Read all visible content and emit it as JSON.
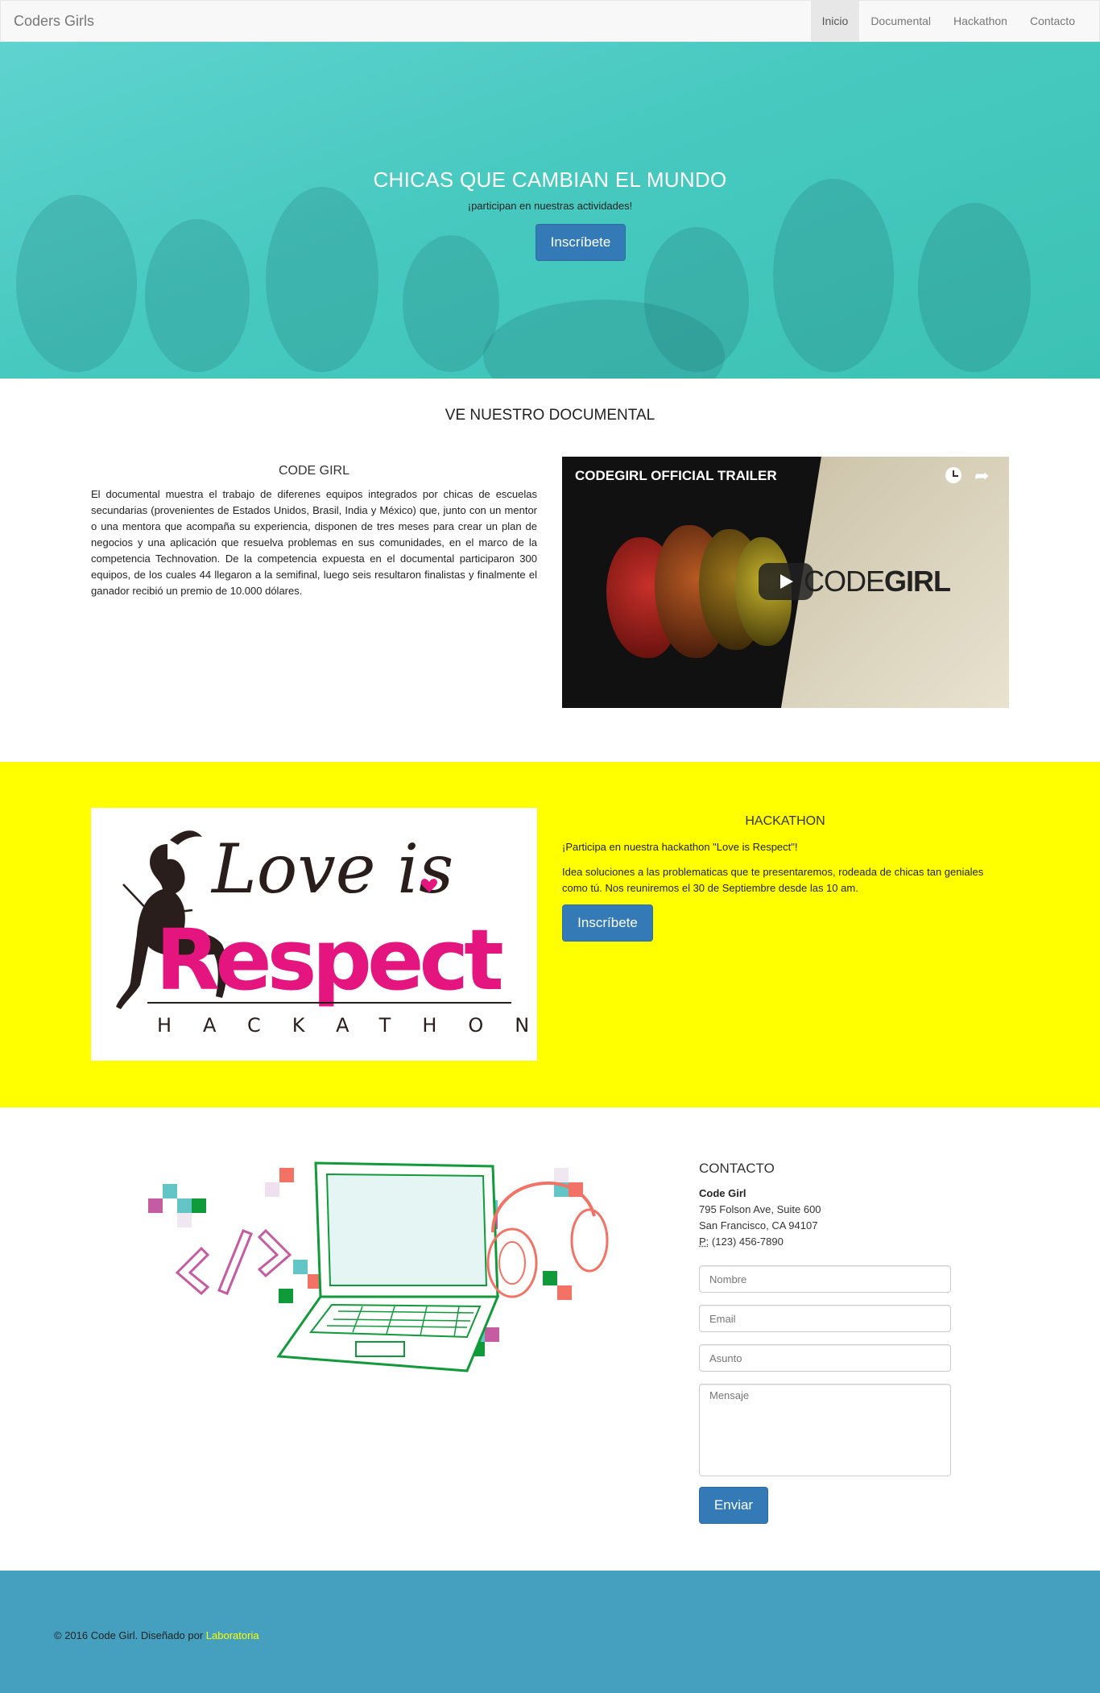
{
  "nav": {
    "brand": "Coders Girls",
    "items": [
      {
        "label": "Inicio",
        "active": true
      },
      {
        "label": "Documental",
        "active": false
      },
      {
        "label": "Hackathon",
        "active": false
      },
      {
        "label": "Contacto",
        "active": false
      }
    ]
  },
  "hero": {
    "title": "CHICAS QUE CAMBIAN EL MUNDO",
    "subtitle": "¡participan en nuestras actividades!",
    "button": "Inscríbete"
  },
  "documental": {
    "section_title": "VE NUESTRO DOCUMENTAL",
    "heading": "CODE GIRL",
    "text": "El documental muestra el trabajo de diferenes equipos integrados por chicas de escuelas secundarias (provenientes de Estados Unidos, Brasil, India y México) que, junto con un mentor o una mentora que acompaña su experiencia, disponen de tres meses para crear un plan de negocios y una aplicación que resuelva problemas en sus comunidades, en el marco de la competencia Technovation. De la competencia expuesta en el documental participaron 300 equipos, de los cuales 44 llegaron a la semifinal, luego seis resultaron finalistas y finalmente el ganador recibió un premio de 10.000 dólares.",
    "video": {
      "title": "CODEGIRL OFFICIAL TRAILER",
      "logo_light": "CODE",
      "logo_bold": "GIRL"
    }
  },
  "hackathon": {
    "heading": "HACKATHON",
    "p1": "¡Participa en nuestra hackathon \"Love is Respect\"!",
    "p2": "Idea soluciones a las problematicas que te presentaremos, rodeada de chicas tan geniales como tú. Nos reuniremos el 30 de Septiembre desde las 10 am.",
    "button": "Inscríbete",
    "logo": {
      "line1": "Love is",
      "line2": "Respect",
      "line3": "HACKATHON"
    }
  },
  "contacto": {
    "heading": "CONTACTO",
    "name": "Code Girl",
    "address1": "795 Folson Ave, Suite 600",
    "address2": "San Francisco, CA 94107",
    "phone_label": "P:",
    "phone": "(123) 456-7890",
    "placeholders": {
      "name": "Nombre",
      "email": "Email",
      "subject": "Asunto",
      "message": "Mensaje"
    },
    "button": "Enviar"
  },
  "footer": {
    "text": "© 2016 Code Girl. Diseñado por ",
    "link": "Laboratoria"
  },
  "colors": {
    "hero": "#47c9c0",
    "hackathon_bg": "#ffff00",
    "footer_bg": "#45a0bf",
    "button": "#337ab7",
    "logo_pink": "#e5157f"
  }
}
